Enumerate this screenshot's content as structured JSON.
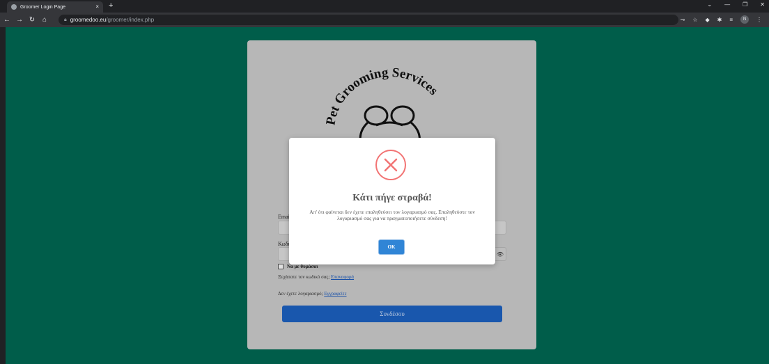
{
  "browser": {
    "tab_title": "Groomer Login Page",
    "tab_close": "×",
    "new_tab": "+",
    "url_domain": "groomedoo.eu",
    "url_path": "/groomer/index.php",
    "profile_initial": "N"
  },
  "logo": {
    "text": "Pet Grooming Services"
  },
  "login": {
    "email_label": "Email",
    "password_label": "Κωδικός",
    "remember_label": "Να με θυμάσαι",
    "forgot_prefix": "Ξεχάσατε τον κωδικό σας;",
    "forgot_link": "Επαναφορά",
    "no_account_prefix": "Δεν έχετε λογαριασμό;",
    "register_link": "Εγγραφείτε",
    "submit_label": "Συνδέσου"
  },
  "modal": {
    "title": "Κάτι πήγε στραβά!",
    "message": "Απ' ότι φαίνεται δεν έχετε επαληθεύσει τον λογαριασμό σας. Επαληθεύστε τον λογαριασμό σας για να πραγματοποιήσετε σύνδεση!",
    "ok_label": "OK"
  },
  "colors": {
    "page_bg": "#00634f",
    "primary": "#1b5db8",
    "error": "#f27474",
    "ok_button": "#3085d6"
  }
}
